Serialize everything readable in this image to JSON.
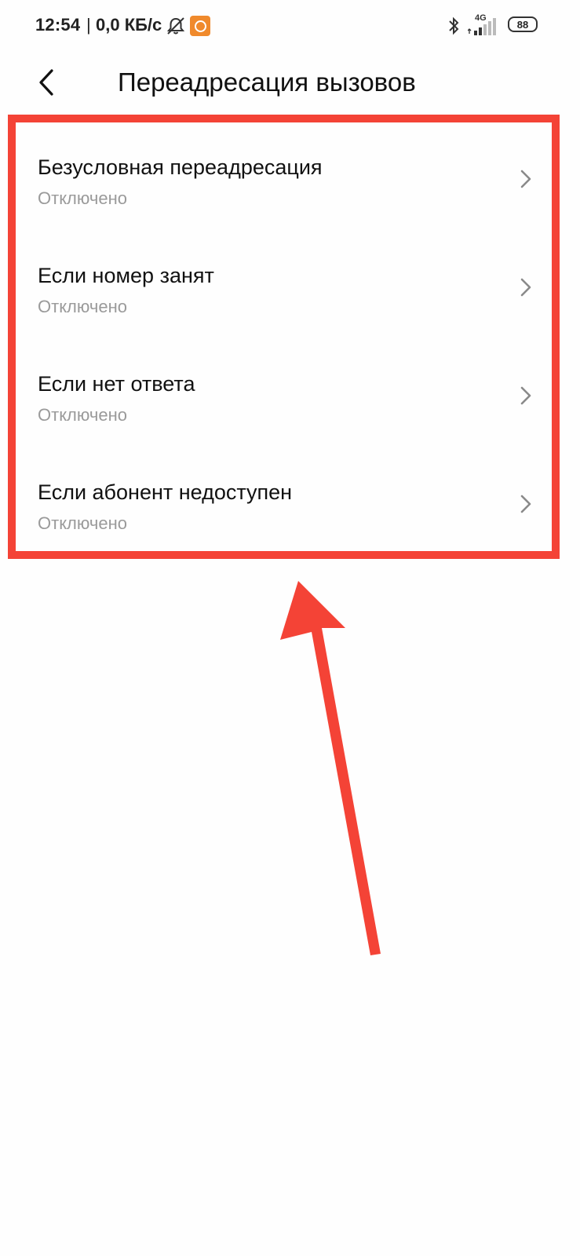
{
  "status_bar": {
    "time": "12:54",
    "separator": "|",
    "speed": "0,0 КБ/с",
    "network": "4G",
    "battery": "88"
  },
  "header": {
    "title": "Переадресация вызовов"
  },
  "forwarding_options": [
    {
      "title": "Безусловная переадресация",
      "status": "Отключено"
    },
    {
      "title": "Если номер занят",
      "status": "Отключено"
    },
    {
      "title": "Если нет ответа",
      "status": "Отключено"
    },
    {
      "title": "Если абонент недоступен",
      "status": "Отключено"
    }
  ],
  "colors": {
    "highlight": "#f44336",
    "subtitle": "#9a9a9a",
    "chevron": "#8a8a8a"
  },
  "icons": {
    "back": "chevron-left-icon",
    "item_action": "chevron-right-icon",
    "bell": "bell-muted-icon",
    "bluetooth": "bluetooth-icon",
    "signal": "signal-icon",
    "battery": "battery-icon"
  }
}
